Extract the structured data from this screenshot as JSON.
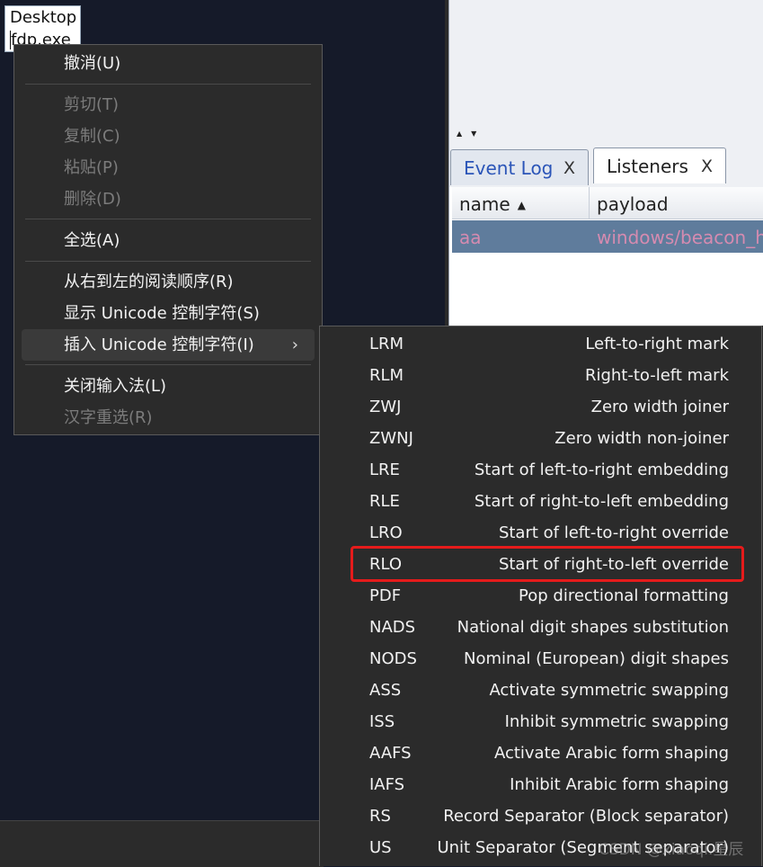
{
  "desktop_label": {
    "line1": "Desktop",
    "line2": "fdp.exe"
  },
  "app": {
    "tabs": [
      {
        "label": "Event Log",
        "close": "X"
      },
      {
        "label": "Listeners",
        "close": "X"
      }
    ],
    "table": {
      "columns": [
        "name",
        "payload"
      ],
      "sort_indicator": "▲",
      "rows": [
        {
          "name": "aa",
          "payload": "windows/beacon_htt"
        }
      ]
    },
    "split_arrows": "▲▼"
  },
  "context_menu": {
    "items": [
      {
        "label": "撤消(U)",
        "enabled": true
      },
      {
        "label": "剪切(T)",
        "enabled": false
      },
      {
        "label": "复制(C)",
        "enabled": false
      },
      {
        "label": "粘贴(P)",
        "enabled": false
      },
      {
        "label": "删除(D)",
        "enabled": false
      },
      {
        "label": "全选(A)",
        "enabled": true
      },
      {
        "label": "从右到左的阅读顺序(R)",
        "enabled": true
      },
      {
        "label": "显示 Unicode 控制字符(S)",
        "enabled": true
      },
      {
        "label": "插入 Unicode 控制字符(I)",
        "enabled": true,
        "submenu": true
      },
      {
        "label": "关闭输入法(L)",
        "enabled": true
      },
      {
        "label": "汉字重选(R)",
        "enabled": false
      }
    ],
    "chevron": "›"
  },
  "submenu": {
    "items": [
      {
        "code": "LRM",
        "desc": "Left-to-right mark"
      },
      {
        "code": "RLM",
        "desc": "Right-to-left mark"
      },
      {
        "code": "ZWJ",
        "desc": "Zero width joiner"
      },
      {
        "code": "ZWNJ",
        "desc": "Zero width non-joiner"
      },
      {
        "code": "LRE",
        "desc": "Start of left-to-right embedding"
      },
      {
        "code": "RLE",
        "desc": "Start of right-to-left embedding"
      },
      {
        "code": "LRO",
        "desc": "Start of left-to-right override"
      },
      {
        "code": "RLO",
        "desc": "Start of right-to-left override",
        "highlighted": true
      },
      {
        "code": "PDF",
        "desc": "Pop directional formatting"
      },
      {
        "code": "NADS",
        "desc": "National digit shapes substitution"
      },
      {
        "code": "NODS",
        "desc": "Nominal (European) digit shapes"
      },
      {
        "code": "ASS",
        "desc": "Activate symmetric swapping"
      },
      {
        "code": "ISS",
        "desc": "Inhibit symmetric swapping"
      },
      {
        "code": "AAFS",
        "desc": "Activate Arabic form shaping"
      },
      {
        "code": "IAFS",
        "desc": "Inhibit Arabic form shaping"
      },
      {
        "code": "RS",
        "desc": "Record Separator (Block separator)"
      },
      {
        "code": "US",
        "desc": "Unit Separator (Segment separator)"
      }
    ],
    "highlight_color": "#e51b1b"
  },
  "watermark": "CSDN @xiaoqi.星辰"
}
